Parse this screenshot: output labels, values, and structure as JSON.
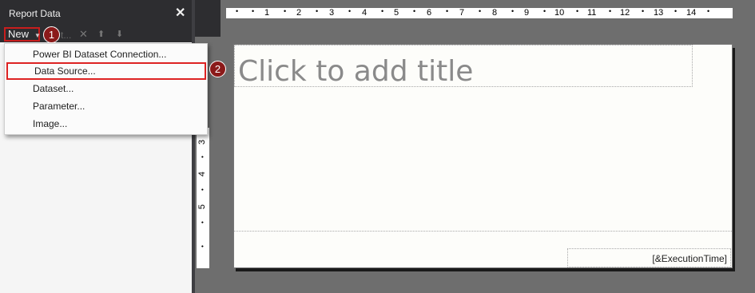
{
  "panel": {
    "title": "Report Data",
    "close_glyph": "✕",
    "new_label": "New",
    "edit_label": "t...",
    "icons": [
      "new-caret-icon",
      "delete-icon",
      "move-up-icon",
      "move-down-icon"
    ]
  },
  "badges": {
    "one": "1",
    "two": "2"
  },
  "menu": {
    "items": [
      "Power BI Dataset Connection...",
      "Data Source...",
      "Dataset...",
      "Parameter...",
      "Image..."
    ]
  },
  "ruler": {
    "numbers": [
      "1",
      "2",
      "3",
      "4",
      "5",
      "6",
      "7",
      "8",
      "9",
      "10",
      "11",
      "12",
      "13",
      "14"
    ],
    "vertical": [
      "3",
      "4",
      "5"
    ]
  },
  "report": {
    "title_placeholder": "Click to add title",
    "execution_time": "[&ExecutionTime]"
  },
  "colors": {
    "highlight": "#d22222",
    "badge": "#8b1a1a"
  }
}
